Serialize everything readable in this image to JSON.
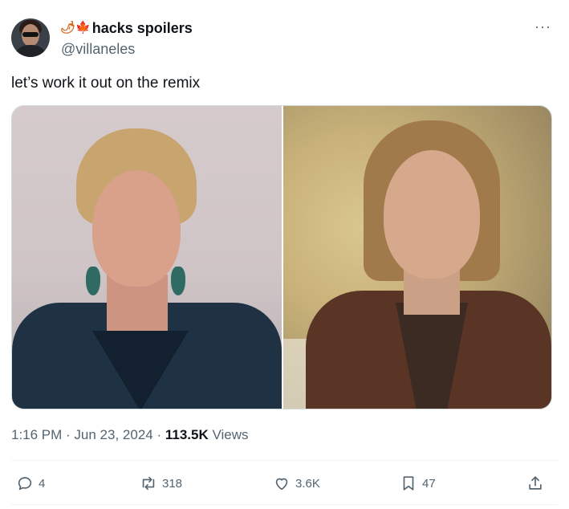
{
  "author": {
    "display_name": "hacks spoilers",
    "handle": "@villaneles",
    "name_emoji": [
      "🌶",
      "🍁"
    ]
  },
  "more_label": "···",
  "tweet": {
    "text": "let’s work it out on the remix"
  },
  "meta": {
    "time": "1:16 PM",
    "sep1": " · ",
    "date": "Jun 23, 2024",
    "sep2": " · ",
    "views_count": "113.5K",
    "views_label": " Views"
  },
  "actions": {
    "replies": "4",
    "reposts": "318",
    "likes": "3.6K",
    "bookmarks": "47"
  },
  "colors": {
    "text_primary": "#0f1419",
    "text_secondary": "#536471",
    "border": "#cfd9de"
  }
}
